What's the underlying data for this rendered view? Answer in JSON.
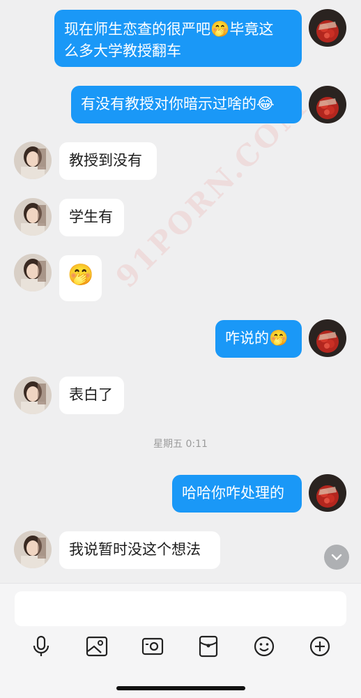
{
  "watermark": "91PORN.COM",
  "messages": [
    {
      "side": "out",
      "line1": "现在师生恋查的很严吧",
      "emoji1": "🤭",
      "line1b": "毕竟这",
      "line2": "么多大学教授翻车"
    },
    {
      "side": "out",
      "text": "有没有教授对你暗示过啥的",
      "emoji": "😂"
    },
    {
      "side": "in",
      "text": "教授到没有"
    },
    {
      "side": "in",
      "text": "学生有"
    },
    {
      "side": "in",
      "emoji": "🤭"
    },
    {
      "side": "out",
      "text": "咋说的",
      "emoji": "🤭"
    },
    {
      "side": "in",
      "text": "表白了"
    },
    {
      "side": "out",
      "text": "哈哈你咋处理的"
    },
    {
      "side": "in",
      "text": "我说暂时没这个想法"
    }
  ],
  "time_divider": "星期五 0:11",
  "colors": {
    "out_bubble": "#1a98f7",
    "in_bubble": "#ffffff",
    "background": "#efeff0"
  },
  "toolbar": {
    "icons": [
      "microphone-icon",
      "photo-icon",
      "camera-icon",
      "red-packet-icon",
      "emoji-icon",
      "plus-icon"
    ]
  },
  "input": {
    "value": "",
    "placeholder": ""
  }
}
